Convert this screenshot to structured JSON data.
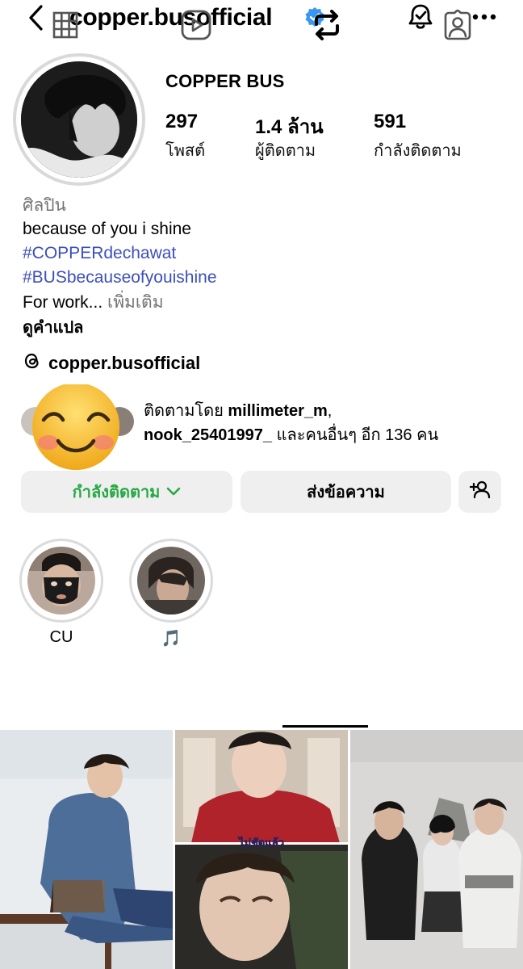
{
  "topbar": {
    "username": "copper.busofficial"
  },
  "profile": {
    "display_name": "COPPER BUS",
    "stats": [
      {
        "value": "297",
        "label": "โพสต์"
      },
      {
        "value": "1.4 ล้าน",
        "label": "ผู้ติดตาม"
      },
      {
        "value": "591",
        "label": "กำลังติดตาม"
      }
    ]
  },
  "bio": {
    "category": "ศิลปิน",
    "line1": "because of you i shine",
    "hashtag1": "#COPPERdechawat",
    "hashtag2": "#BUSbecauseofyouishine",
    "more_prefix": "For work... ",
    "more_link": "เพิ่มเติม",
    "translate": "ดูคำแปล",
    "threads_handle": "copper.busofficial"
  },
  "followed_by": {
    "prefix": "ติดตามโดย ",
    "user1": "millimeter_m",
    "sep": ",",
    "user2": "nook_25401997_",
    "suffix": " และคนอื่นๆ อีก 136 คน"
  },
  "buttons": {
    "following": "กำลังติดตาม",
    "message": "ส่งข้อความ"
  },
  "highlights": [
    {
      "label": "CU"
    },
    {
      "label": "🎵"
    }
  ],
  "grid": {
    "reel_caption": "ไม่ชัดแล้ว"
  },
  "colors": {
    "link": "#3c4fbd",
    "following_green": "#27a844",
    "verified_blue": "#3897f0",
    "button_bg": "#efefef"
  },
  "icons": {
    "back": "chevron-left-icon",
    "verified": "verified-badge-icon",
    "notifications": "bell-check-icon",
    "more": "more-horizontal-icon",
    "threads": "threads-icon",
    "chevron": "chevron-down-icon",
    "add_user": "add-user-icon",
    "tabs": [
      "grid-icon",
      "reels-icon",
      "reposts-icon",
      "tagged-icon"
    ]
  }
}
